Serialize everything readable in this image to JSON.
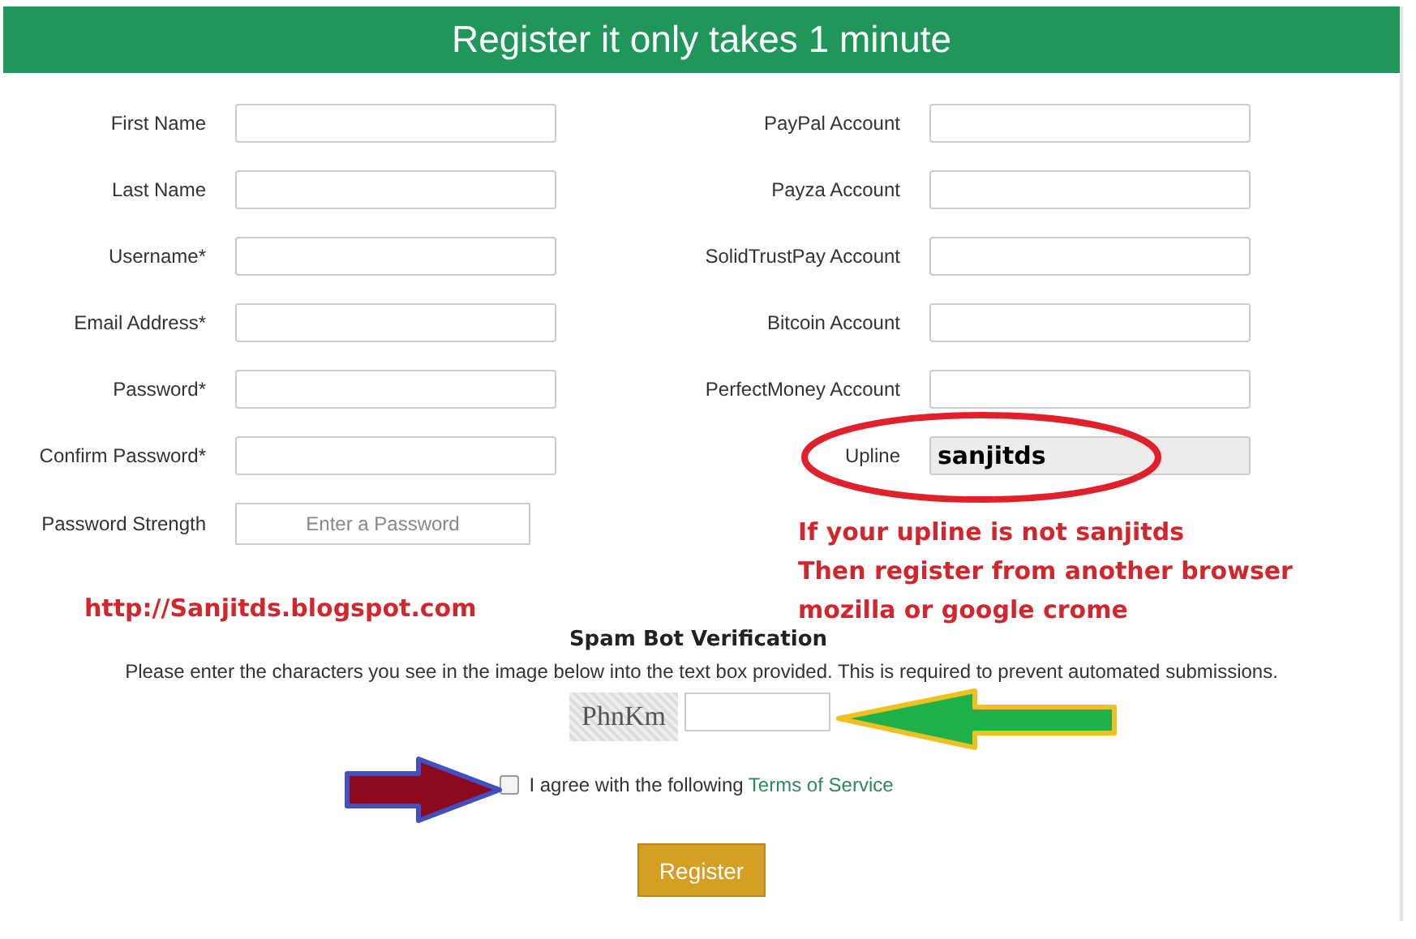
{
  "header": {
    "title": "Register it only takes 1 minute"
  },
  "left_fields": [
    {
      "label": "First Name",
      "kind": "text"
    },
    {
      "label": "Last Name",
      "kind": "text"
    },
    {
      "label": "Username*",
      "kind": "text"
    },
    {
      "label": "Email Address*",
      "kind": "text"
    },
    {
      "label": "Password*",
      "kind": "password"
    },
    {
      "label": "Confirm Password*",
      "kind": "password"
    },
    {
      "label": "Password Strength",
      "kind": "strength",
      "placeholder": "Enter a Password"
    }
  ],
  "right_fields": [
    {
      "label": "PayPal Account",
      "kind": "text"
    },
    {
      "label": "Payza Account",
      "kind": "text"
    },
    {
      "label": "SolidTrustPay Account",
      "kind": "text"
    },
    {
      "label": "Bitcoin Account",
      "kind": "text"
    },
    {
      "label": "PerfectMoney Account",
      "kind": "text"
    },
    {
      "label": "Upline",
      "kind": "readonly",
      "value": "sanjitds"
    }
  ],
  "verification": {
    "title": "Spam Bot Verification",
    "instructions": "Please enter the characters you see in the image below into the text box provided. This is required to prevent automated submissions.",
    "captcha": "PhnKm"
  },
  "agree": {
    "checked": false,
    "text": "I agree with the following ",
    "link": "Terms of Service"
  },
  "register_button": "Register",
  "annotations": {
    "site_note": "http://Sanjitds.blogspot.com",
    "upline_note": [
      "If your upline is not sanjitds",
      "Then register from another browser",
      "mozilla or google crome"
    ]
  }
}
